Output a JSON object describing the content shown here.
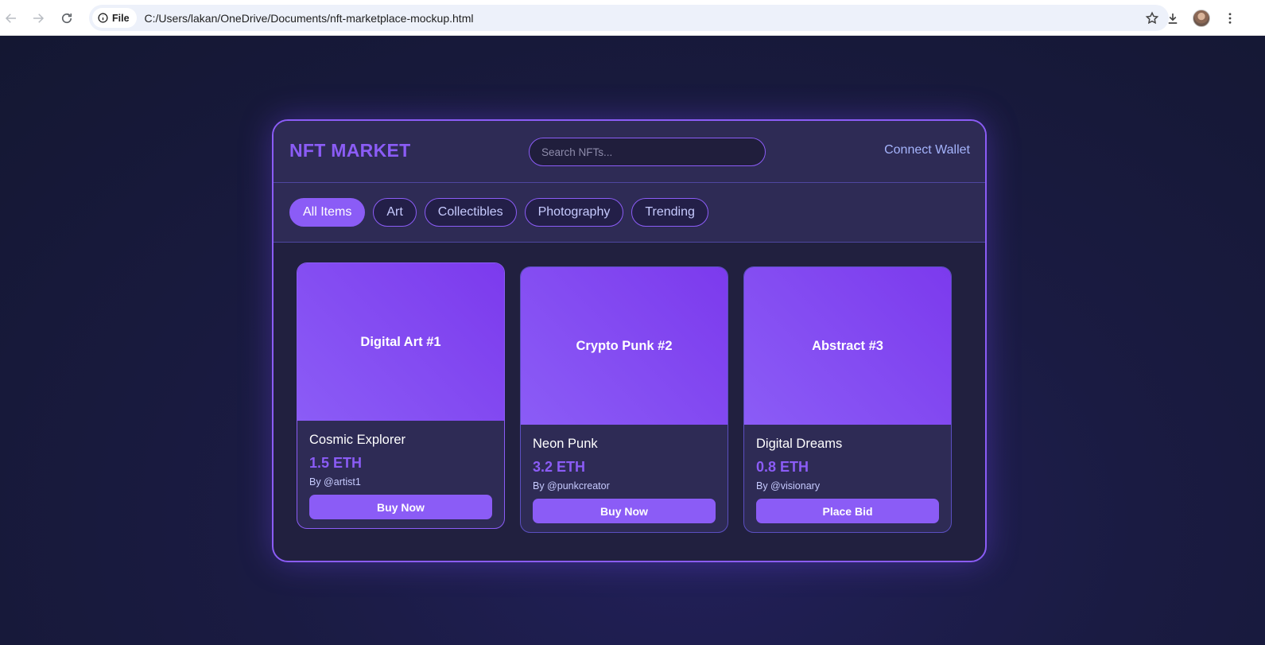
{
  "browser": {
    "file_chip": "File",
    "url": "C:/Users/lakan/OneDrive/Documents/nft-marketplace-mockup.html"
  },
  "header": {
    "logo": "NFT MARKET",
    "search_placeholder": "Search NFTs...",
    "connect_wallet": "Connect Wallet"
  },
  "filters": [
    {
      "label": "All Items",
      "active": true
    },
    {
      "label": "Art",
      "active": false
    },
    {
      "label": "Collectibles",
      "active": false
    },
    {
      "label": "Photography",
      "active": false
    },
    {
      "label": "Trending",
      "active": false
    }
  ],
  "cards": [
    {
      "image_label": "Digital Art #1",
      "title": "Cosmic Explorer",
      "price": "1.5 ETH",
      "creator": "By @artist1",
      "button": "Buy Now"
    },
    {
      "image_label": "Crypto Punk #2",
      "title": "Neon Punk",
      "price": "3.2 ETH",
      "creator": "By @punkcreator",
      "button": "Buy Now"
    },
    {
      "image_label": "Abstract #3",
      "title": "Digital Dreams",
      "price": "0.8 ETH",
      "creator": "By @visionary",
      "button": "Place Bid"
    }
  ],
  "colors": {
    "accent": "#8b5cf6",
    "panel": "#2e2b55",
    "background": "#161a35"
  }
}
